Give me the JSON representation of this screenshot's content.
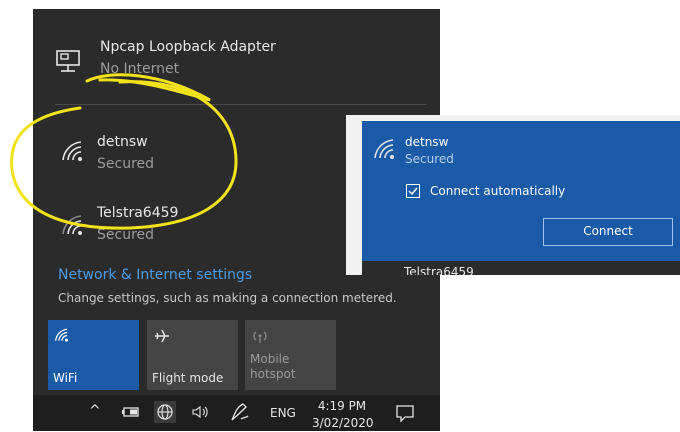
{
  "flyout": {
    "networks": [
      {
        "name": "Npcap Loopback Adapter",
        "status": "No Internet",
        "icon": "ethernet-icon"
      },
      {
        "name": "detnsw",
        "status": "Secured",
        "icon": "wifi-icon"
      },
      {
        "name": "Telstra6459",
        "status": "Secured",
        "icon": "wifi-icon"
      }
    ],
    "settings_link": "Network & Internet settings",
    "settings_hint": "Change settings, such as making a connection metered.",
    "tiles": [
      {
        "label": "WiFi",
        "icon": "wifi-icon",
        "active": true
      },
      {
        "label": "Flight mode",
        "icon": "airplane-icon",
        "active": false
      },
      {
        "label_line1": "Mobile",
        "label_line2": "hotspot",
        "icon": "hotspot-icon",
        "active": false
      }
    ]
  },
  "taskbar": {
    "time": "4:19 PM",
    "date": "3/02/2020",
    "language": "ENG"
  },
  "popup": {
    "network_name": "detnsw",
    "network_status": "Secured",
    "auto_connect_label": "Connect automatically",
    "auto_connect_checked": true,
    "connect_label": "Connect",
    "partial_next": "Telstra6459"
  },
  "colors": {
    "flyout_bg": "#2b2b2b",
    "accent": "#1a5aa6",
    "tile_active": "#1a5aa6",
    "tile_inactive": "#444444",
    "link": "#4a9de6",
    "annotation": "#f2e21a"
  }
}
